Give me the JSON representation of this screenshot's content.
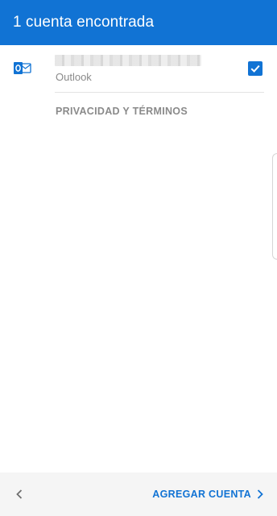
{
  "header": {
    "title": "1 cuenta encontrada"
  },
  "account": {
    "email": "",
    "provider": "Outlook",
    "checked": true,
    "icon": "outlook-icon"
  },
  "links": {
    "privacy": "PRIVACIDAD Y TÉRMINOS"
  },
  "footer": {
    "back_icon": "chevron-left-icon",
    "add_account_label": "AGREGAR CUENTA",
    "add_account_icon": "chevron-right-icon"
  },
  "colors": {
    "accent": "#1173d4",
    "footer_bg": "#f5f5f5",
    "secondary_text": "#8a8a8a"
  }
}
